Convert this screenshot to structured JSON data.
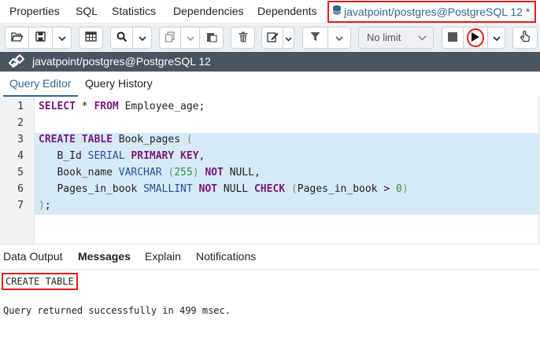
{
  "top_tabs": {
    "properties": "Properties",
    "sql": "SQL",
    "statistics": "Statistics",
    "dependencies": "Dependencies",
    "dependents": "Dependents",
    "query_tool": "javatpoint/postgres@PostgreSQL 12 *"
  },
  "toolbar": {
    "limit_value": "No limit",
    "icons": [
      "folder-open-icon",
      "save-icon",
      "chevron-down-icon",
      "grid-icon",
      "search-icon",
      "chevron-down-icon",
      "copy-icon",
      "paste-icon",
      "delete-icon",
      "edit-icon",
      "chevron-down-icon",
      "filter-icon",
      "chevron-down-icon",
      "stop-icon",
      "run-icon",
      "chevron-down-icon",
      "pointer-icon"
    ]
  },
  "title_bar": {
    "connection": "javatpoint/postgres@PostgreSQL 12",
    "icon": "connection-plug-icon"
  },
  "editor_tabs": {
    "query_editor": "Query Editor",
    "query_history": "Query History"
  },
  "editor": {
    "line_numbers": [
      "1",
      "2",
      "3",
      "4",
      "5",
      "6",
      "7"
    ],
    "lines": [
      "SELECT * FROM Employee_age;",
      "",
      "CREATE TABLE Book_pages (",
      "   B_Id SERIAL PRIMARY KEY,",
      "   Book_name VARCHAR (255) NOT NULL,",
      "   Pages_in_book SMALLINT NOT NULL CHECK (Pages_in_book > 0)",
      ");"
    ]
  },
  "messages": {
    "tabs": {
      "data_output": "Data Output",
      "messages": "Messages",
      "explain": "Explain",
      "notifications": "Notifications"
    },
    "result": "CREATE TABLE",
    "detail": "Query returned successfully in 499 msec."
  },
  "colors": {
    "accent": "#326690",
    "highlight_red": "#e0201d",
    "title_bar_bg": "#4a5561",
    "selection_bg": "#d6eaf6"
  }
}
